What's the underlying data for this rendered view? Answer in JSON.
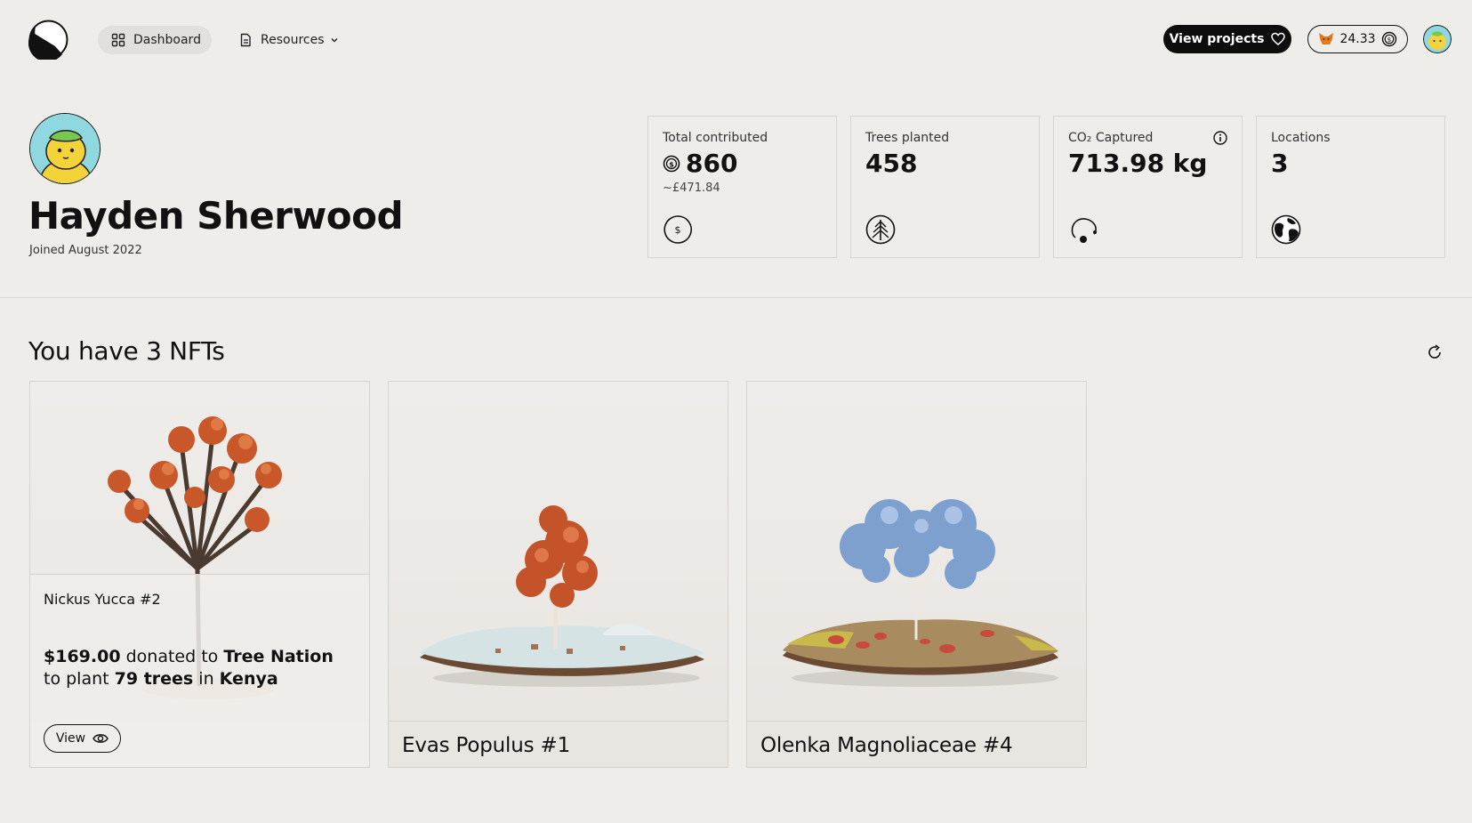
{
  "nav": {
    "dashboard_label": "Dashboard",
    "resources_label": "Resources",
    "view_projects_label": "View projects",
    "wallet_balance": "24.33"
  },
  "profile": {
    "name": "Hayden Sherwood",
    "joined": "Joined August 2022"
  },
  "stats": [
    {
      "label": "Total contributed",
      "value": "860",
      "sub": "~£471.84",
      "icon": "dollar-coin-icon"
    },
    {
      "label": "Trees planted",
      "value": "458",
      "icon": "tree-icon"
    },
    {
      "label": "CO₂ Captured",
      "value": "713.98 kg",
      "icon": "co2-cloud-icon"
    },
    {
      "label": "Locations",
      "value": "3",
      "icon": "globe-icon"
    }
  ],
  "nfts": {
    "title": "You have 3 NFTs",
    "items": [
      {
        "name": "Nickus Yucca #2",
        "amount": "$169.00",
        "donated_to": "donated to",
        "org": "Tree Nation",
        "to": "to",
        "plant": "plant",
        "trees": "79 trees",
        "in": "in",
        "location": "Kenya",
        "view_label": "View"
      },
      {
        "name": "Evas Populus #1"
      },
      {
        "name": "Olenka Magnoliaceae #4"
      }
    ]
  },
  "colors": {
    "background": "#efedea",
    "dark": "#0d0d0d",
    "avatar_bg": "#8fd8e0",
    "avatar_face": "#f4d23a"
  }
}
